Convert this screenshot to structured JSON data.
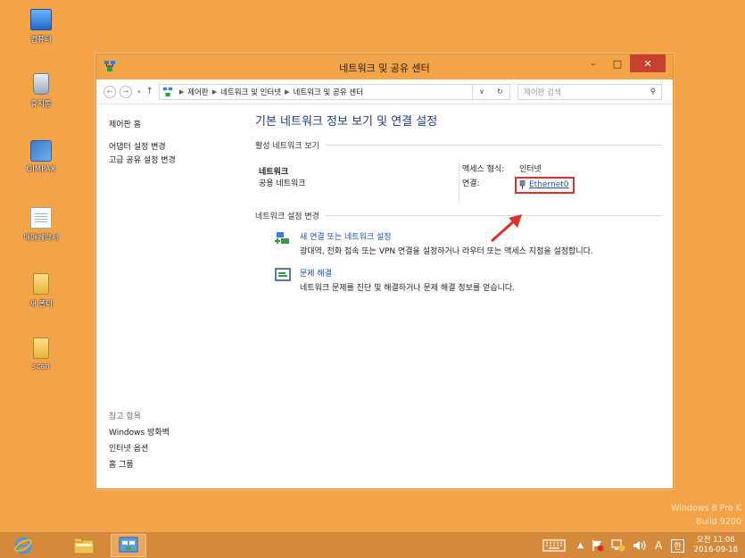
{
  "desktop": {
    "icons": [
      {
        "label": "컴퓨터",
        "icon": "computer-icon"
      },
      {
        "label": "휴지통",
        "icon": "recycle-bin-icon"
      },
      {
        "label": "GIMPAX",
        "icon": "gimpax-app-icon"
      },
      {
        "label": "매매계약서",
        "icon": "document-icon"
      },
      {
        "label": "새 폴더",
        "icon": "folder-icon"
      },
      {
        "label": "scan",
        "icon": "folder-icon"
      }
    ]
  },
  "window": {
    "title": "네트워크 및 공유 센터",
    "minimize_glyph": "–",
    "maximize_glyph": "□",
    "close_glyph": "✕",
    "address": {
      "back": "←",
      "forward": "→",
      "recent": "▾",
      "up": "↑",
      "crumbs": [
        "제어판",
        "네트워크 및 인터넷",
        "네트워크 및 공유 센터"
      ],
      "history_dropdown": "∨",
      "refresh": "↻",
      "search_placeholder": "제어판 검색",
      "search_glyph": "⚲"
    },
    "left_pane": {
      "home": "제어판 홈",
      "tasks": [
        "어댑터 설정 변경",
        "고급 공유 설정 변경"
      ],
      "see_also_header": "참고 항목",
      "see_also": [
        "Windows 방화벽",
        "인터넷 옵션",
        "홈 그룹"
      ]
    },
    "main": {
      "title": "기본 네트워크 정보 보기 및 연결 설정",
      "active_header": "활성 네트워크 보기",
      "network_name": "네트워크",
      "network_type": "공용 네트워크",
      "access_type_label": "액세스 형식:",
      "access_type_value": "인터넷",
      "connection_label": "연결:",
      "connection_value": "Ethernet0",
      "change_header": "네트워크 설정 변경",
      "items": [
        {
          "link": "새 연결 또는 네트워크 설정",
          "desc": "광대역, 전화 접속 또는 VPN 연결을 설정하거나 라우터 또는 액세스 지점을 설정합니다."
        },
        {
          "link": "문제 해결",
          "desc": "네트워크 문제를 진단 및 해결하거나 문제 해결 정보를 얻습니다."
        }
      ]
    }
  },
  "watermark": {
    "line1": "Windows 8 Pro K",
    "line2": "Build 9200"
  },
  "taskbar": {
    "tray_up": "▲",
    "ime_mode": "A",
    "ime_lang": "한",
    "clock_time": "오전 11:06",
    "clock_date": "2016-09-18"
  },
  "colors": {
    "desktop": "#f4a448",
    "link": "#1a4fbf",
    "highlight": "#e0302a",
    "close_button": "#c7412c"
  }
}
